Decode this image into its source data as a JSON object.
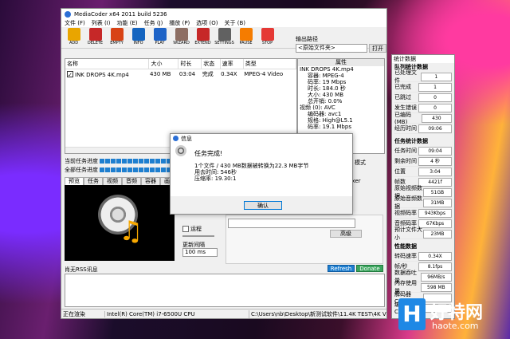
{
  "main": {
    "title": "MediaCoder x64 2011 build 5236",
    "menu": [
      "文件 (F)",
      "列表 (I)",
      "功能 (E)",
      "任务 (J)",
      "播放 (P)",
      "选项 (O)",
      "关于 (B)"
    ],
    "toolbar": [
      {
        "label": "ADD",
        "color": "#e9a500"
      },
      {
        "label": "DELETE",
        "color": "#c62828"
      },
      {
        "label": "EMPTY",
        "color": "#d84315"
      },
      {
        "label": "INFO",
        "color": "#1565c0"
      },
      {
        "label": "PLAY",
        "color": "#1e63c7"
      },
      {
        "label": "WIZARD",
        "color": "#8d6e63"
      },
      {
        "label": "EXTEND",
        "color": "#c62828"
      },
      {
        "label": "SETTINGS",
        "color": "#616161"
      },
      {
        "label": "PAUSE",
        "color": "#f57c00"
      },
      {
        "label": "STOP",
        "color": "#e53935"
      }
    ],
    "output": {
      "label": "输出路径",
      "value": "<原始文件夹>",
      "open": "打开"
    },
    "columns": [
      "名称",
      "大小",
      "时长",
      "状态",
      "速率",
      "类型"
    ],
    "file": {
      "name": "INK DROPS 4K.mp4",
      "size": "430 MB",
      "duration": "03:04",
      "status": "完成",
      "rate": "0.34X",
      "type": "MPEG-4 Video"
    },
    "props": {
      "header": "属性",
      "lines": [
        "INK DROPS 4K.mp4",
        "容器: MPEG-4",
        "码率: 19 Mbps",
        "时长: 184.0 秒",
        "大小: 430 MB",
        "总开销: 0.0%",
        "视频 (0): AVC",
        "编码器: avc1",
        "规格: High@L5.1",
        "码率: 19.1 Mbps"
      ]
    },
    "progress": {
      "current": "当前任务进度",
      "all": "全部任务进度"
    },
    "tabs": [
      "预览",
      "任务",
      "视频",
      "音频",
      "容器",
      "画面"
    ],
    "mode_label": "模式",
    "tab_right": "uxer",
    "checkbox_label": "运程",
    "refresh_label": "更新间隔",
    "refresh_value": "100 ms",
    "advanced_btn": "高级",
    "rss_label": "肖无RSS讯息",
    "refresh_btn": "Refresh",
    "donate_btn": "Donate",
    "status": {
      "left": "正在渲染",
      "cpu": "Intel(R) Core(TM) i7-6500U CPU",
      "path": "C:\\Users\\nb\\Desktop\\新测试软件\\11.4K TEST\\4K Vide"
    }
  },
  "dialog": {
    "title": "信息",
    "heading": "任务完成!",
    "line1": "1个文件 / 430 MB数据被转换为22.3 MB字节",
    "line2": "用去时间: 546秒",
    "line3": "压缩率: 19.30:1",
    "ok": "确认"
  },
  "stats": {
    "title": "统计数据",
    "sections": [
      {
        "name": "队列统计数据",
        "rows": [
          [
            "已处理文件",
            "1"
          ],
          [
            "已完成",
            "1"
          ],
          [
            "已跳过",
            "0"
          ],
          [
            "发生错误",
            "0"
          ],
          [
            "已编码(MB)",
            "430"
          ],
          [
            "经历时间",
            "09:06"
          ]
        ]
      },
      {
        "name": "任务统计数据",
        "rows": [
          [
            "任务时间",
            "09:04"
          ],
          [
            "剩余时间",
            "4 秒"
          ],
          [
            "位置",
            "3:04"
          ],
          [
            "帧数",
            "4421f"
          ],
          [
            "原始视频数据",
            "51GB"
          ],
          [
            "原始音频数据",
            "31MB"
          ],
          [
            "视频码率",
            "943Kbps"
          ],
          [
            "音频码率",
            "67Kbps"
          ],
          [
            "预计文件大小",
            "23MB"
          ]
        ]
      },
      {
        "name": "性能数据",
        "rows": [
          [
            "转码速率",
            "0.34X"
          ],
          [
            "帧/秒",
            "8.1fps"
          ],
          [
            "数据吞吐量",
            "96MB/s"
          ],
          [
            "内存使用量",
            "598 MB"
          ],
          [
            "解码器CPU%",
            ""
          ],
          [
            "编码器CPU%",
            ""
          ]
        ]
      }
    ]
  },
  "watermark": {
    "brand": "好特网",
    "url": "haote.com",
    "glyph": "H"
  }
}
